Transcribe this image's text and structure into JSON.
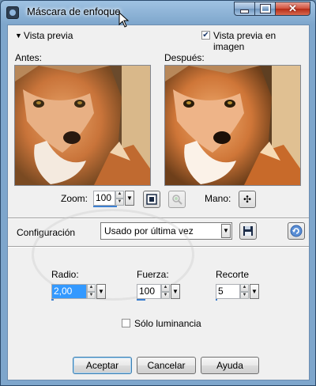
{
  "window": {
    "title": "Máscara de enfoque",
    "buttons": {
      "minimize_icon": "minimize-icon",
      "maximize_icon": "maximize-icon",
      "close_icon": "close-icon"
    }
  },
  "preview": {
    "toggle_label": "Vista previa",
    "in_image_label": "Vista previa en imagen",
    "in_image_checked": true,
    "before_label": "Antes:",
    "after_label": "Después:",
    "zoom_label": "Zoom:",
    "zoom_value": "100",
    "pan_label": "Mano:"
  },
  "settings": {
    "label": "Configuración",
    "preset_value": "Usado por última vez"
  },
  "params": {
    "radius": {
      "label": "Radio:",
      "value": "2,00"
    },
    "strength": {
      "label": "Fuerza:",
      "value": "100"
    },
    "clipping": {
      "label": "Recorte",
      "value": "5"
    },
    "luminance_only": {
      "label": "Sólo luminancia",
      "checked": false
    }
  },
  "actions": {
    "ok": "Aceptar",
    "cancel": "Cancelar",
    "help": "Ayuda"
  },
  "colors": {
    "title_gradient": "#7ea6cc",
    "close_button": "#c8452d",
    "progress_blue": "#3c7fcf",
    "selection_blue": "#3399ff"
  }
}
